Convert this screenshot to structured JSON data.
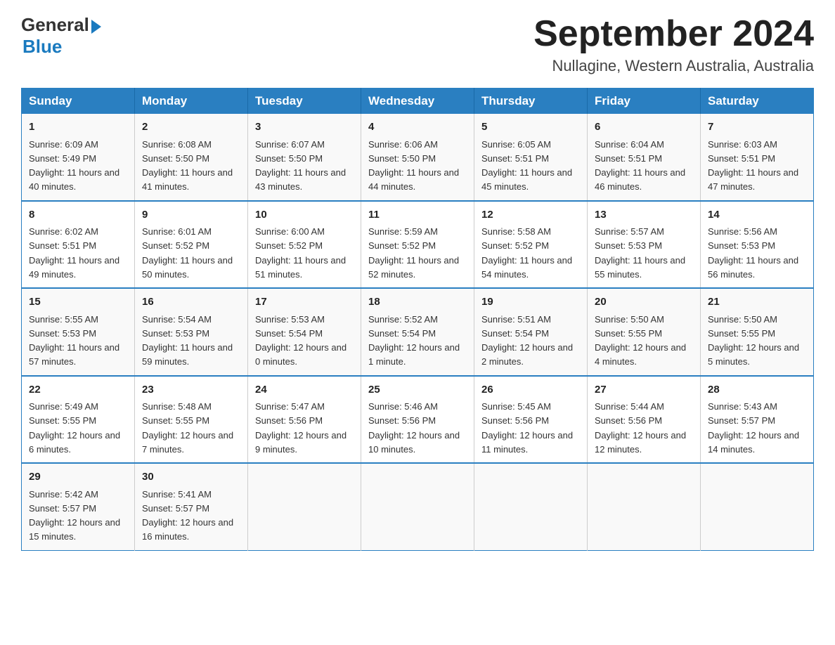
{
  "header": {
    "logo_general": "General",
    "logo_blue": "Blue",
    "month_title": "September 2024",
    "location": "Nullagine, Western Australia, Australia"
  },
  "days_of_week": [
    "Sunday",
    "Monday",
    "Tuesday",
    "Wednesday",
    "Thursday",
    "Friday",
    "Saturday"
  ],
  "weeks": [
    [
      {
        "day": "1",
        "sunrise": "6:09 AM",
        "sunset": "5:49 PM",
        "daylight": "11 hours and 40 minutes."
      },
      {
        "day": "2",
        "sunrise": "6:08 AM",
        "sunset": "5:50 PM",
        "daylight": "11 hours and 41 minutes."
      },
      {
        "day": "3",
        "sunrise": "6:07 AM",
        "sunset": "5:50 PM",
        "daylight": "11 hours and 43 minutes."
      },
      {
        "day": "4",
        "sunrise": "6:06 AM",
        "sunset": "5:50 PM",
        "daylight": "11 hours and 44 minutes."
      },
      {
        "day": "5",
        "sunrise": "6:05 AM",
        "sunset": "5:51 PM",
        "daylight": "11 hours and 45 minutes."
      },
      {
        "day": "6",
        "sunrise": "6:04 AM",
        "sunset": "5:51 PM",
        "daylight": "11 hours and 46 minutes."
      },
      {
        "day": "7",
        "sunrise": "6:03 AM",
        "sunset": "5:51 PM",
        "daylight": "11 hours and 47 minutes."
      }
    ],
    [
      {
        "day": "8",
        "sunrise": "6:02 AM",
        "sunset": "5:51 PM",
        "daylight": "11 hours and 49 minutes."
      },
      {
        "day": "9",
        "sunrise": "6:01 AM",
        "sunset": "5:52 PM",
        "daylight": "11 hours and 50 minutes."
      },
      {
        "day": "10",
        "sunrise": "6:00 AM",
        "sunset": "5:52 PM",
        "daylight": "11 hours and 51 minutes."
      },
      {
        "day": "11",
        "sunrise": "5:59 AM",
        "sunset": "5:52 PM",
        "daylight": "11 hours and 52 minutes."
      },
      {
        "day": "12",
        "sunrise": "5:58 AM",
        "sunset": "5:52 PM",
        "daylight": "11 hours and 54 minutes."
      },
      {
        "day": "13",
        "sunrise": "5:57 AM",
        "sunset": "5:53 PM",
        "daylight": "11 hours and 55 minutes."
      },
      {
        "day": "14",
        "sunrise": "5:56 AM",
        "sunset": "5:53 PM",
        "daylight": "11 hours and 56 minutes."
      }
    ],
    [
      {
        "day": "15",
        "sunrise": "5:55 AM",
        "sunset": "5:53 PM",
        "daylight": "11 hours and 57 minutes."
      },
      {
        "day": "16",
        "sunrise": "5:54 AM",
        "sunset": "5:53 PM",
        "daylight": "11 hours and 59 minutes."
      },
      {
        "day": "17",
        "sunrise": "5:53 AM",
        "sunset": "5:54 PM",
        "daylight": "12 hours and 0 minutes."
      },
      {
        "day": "18",
        "sunrise": "5:52 AM",
        "sunset": "5:54 PM",
        "daylight": "12 hours and 1 minute."
      },
      {
        "day": "19",
        "sunrise": "5:51 AM",
        "sunset": "5:54 PM",
        "daylight": "12 hours and 2 minutes."
      },
      {
        "day": "20",
        "sunrise": "5:50 AM",
        "sunset": "5:55 PM",
        "daylight": "12 hours and 4 minutes."
      },
      {
        "day": "21",
        "sunrise": "5:50 AM",
        "sunset": "5:55 PM",
        "daylight": "12 hours and 5 minutes."
      }
    ],
    [
      {
        "day": "22",
        "sunrise": "5:49 AM",
        "sunset": "5:55 PM",
        "daylight": "12 hours and 6 minutes."
      },
      {
        "day": "23",
        "sunrise": "5:48 AM",
        "sunset": "5:55 PM",
        "daylight": "12 hours and 7 minutes."
      },
      {
        "day": "24",
        "sunrise": "5:47 AM",
        "sunset": "5:56 PM",
        "daylight": "12 hours and 9 minutes."
      },
      {
        "day": "25",
        "sunrise": "5:46 AM",
        "sunset": "5:56 PM",
        "daylight": "12 hours and 10 minutes."
      },
      {
        "day": "26",
        "sunrise": "5:45 AM",
        "sunset": "5:56 PM",
        "daylight": "12 hours and 11 minutes."
      },
      {
        "day": "27",
        "sunrise": "5:44 AM",
        "sunset": "5:56 PM",
        "daylight": "12 hours and 12 minutes."
      },
      {
        "day": "28",
        "sunrise": "5:43 AM",
        "sunset": "5:57 PM",
        "daylight": "12 hours and 14 minutes."
      }
    ],
    [
      {
        "day": "29",
        "sunrise": "5:42 AM",
        "sunset": "5:57 PM",
        "daylight": "12 hours and 15 minutes."
      },
      {
        "day": "30",
        "sunrise": "5:41 AM",
        "sunset": "5:57 PM",
        "daylight": "12 hours and 16 minutes."
      },
      null,
      null,
      null,
      null,
      null
    ]
  ],
  "labels": {
    "sunrise_prefix": "Sunrise: ",
    "sunset_prefix": "Sunset: ",
    "daylight_prefix": "Daylight: "
  }
}
